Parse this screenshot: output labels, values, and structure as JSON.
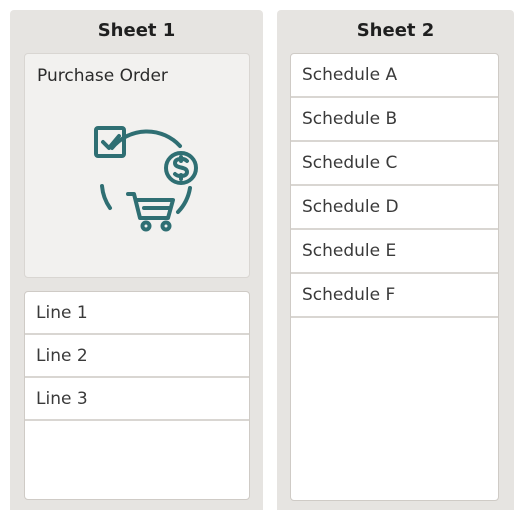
{
  "sheet1": {
    "title": "Sheet 1",
    "purchase_order": {
      "label": "Purchase Order",
      "icon": "purchase-order-icon"
    },
    "lines": [
      "Line 1",
      "Line 2",
      "Line 3"
    ]
  },
  "sheet2": {
    "title": "Sheet 2",
    "schedules": [
      "Schedule A",
      "Schedule B",
      "Schedule C",
      "Schedule D",
      "Schedule E",
      "Schedule F"
    ]
  },
  "colors": {
    "icon": "#2f6f73",
    "sheet_bg": "#e6e4e1",
    "card_bg": "#f2f1ef"
  }
}
